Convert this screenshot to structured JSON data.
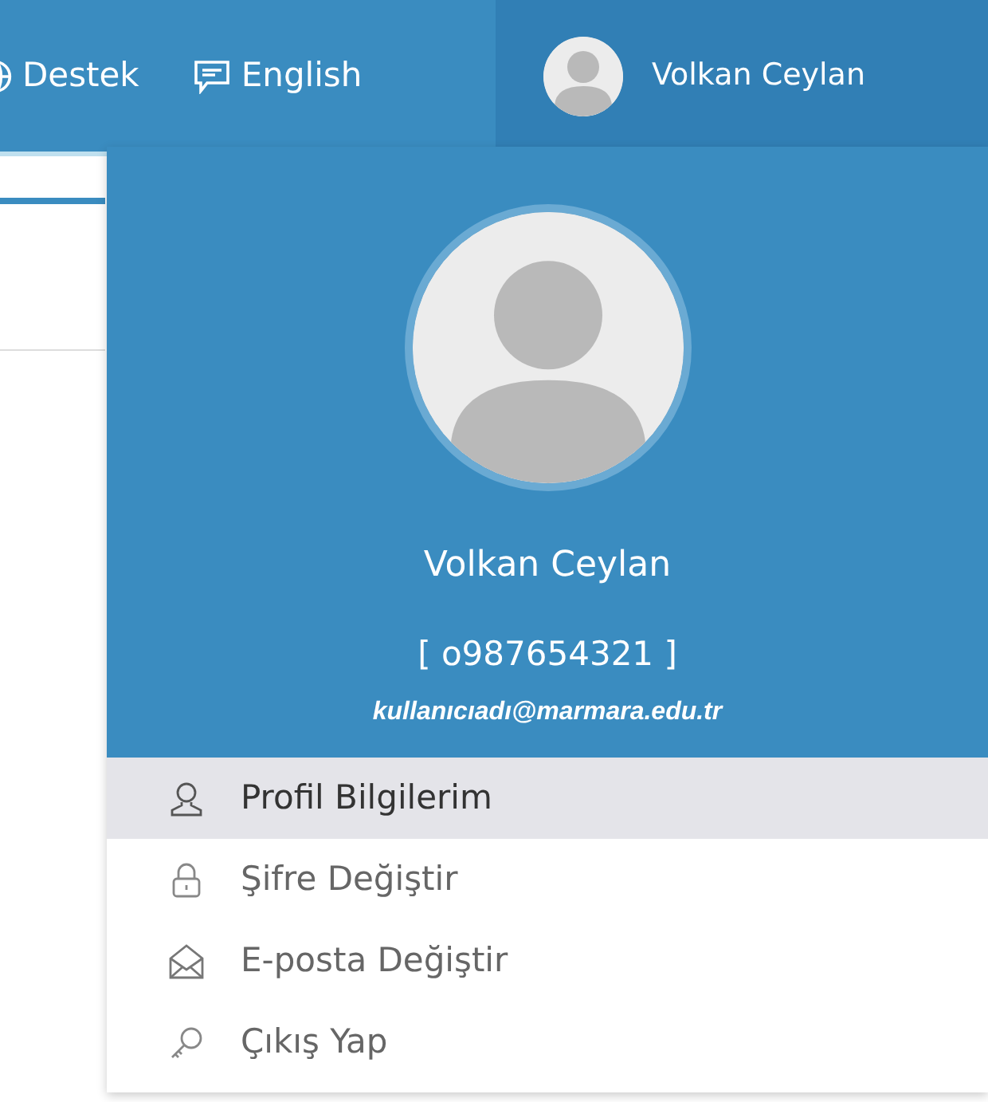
{
  "topbar": {
    "links": [
      {
        "label": "Destek"
      },
      {
        "label": "English"
      }
    ],
    "user_name": "Volkan Ceylan"
  },
  "dropdown": {
    "name": "Volkan Ceylan",
    "user_id": "[ o987654321 ]",
    "email": "kullanıcıadı@marmara.edu.tr",
    "items": [
      {
        "label": "Profil Bilgilerim",
        "selected": true
      },
      {
        "label": "Şifre Değiştir",
        "selected": false
      },
      {
        "label": "E-posta Değiştir",
        "selected": false
      },
      {
        "label": "Çıkış Yap",
        "selected": false
      }
    ]
  }
}
